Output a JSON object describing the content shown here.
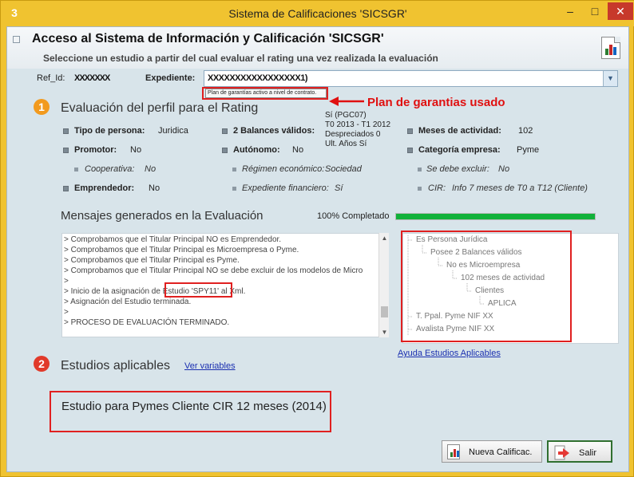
{
  "window": {
    "title": "Sistema de Calificaciones 'SICSGR'",
    "app_icon": "3",
    "min": "–",
    "max": "□",
    "close": "✕"
  },
  "header": {
    "title": "Acceso al Sistema de Información y Calificación 'SICSGR'",
    "subtitle": "Seleccione un estudio a partir del cual evaluar el rating una vez realizada la evaluación"
  },
  "ref": {
    "ref_label": "Ref_Id:",
    "ref_value": "XXXXXXX",
    "exp_label": "Expediente:",
    "exp_value": "XXXXXXXXXXXXXXXXX1)",
    "tooltip": "Plan de garantías activo a nivel de contrato."
  },
  "annotation": {
    "text": "Plan de garantias usado",
    "color": "#e01010"
  },
  "section1": {
    "number": "1",
    "title": "Evaluación del perfil para el Rating",
    "tipo_label": "Tipo de persona:",
    "tipo_value": "Juridica",
    "balances_label": "2 Balances válidos:",
    "balances_value": [
      "Sí (PGC07)",
      "T0 2013 - T1 2012",
      "Despreciados 0",
      "Ult. Años Sí"
    ],
    "meses_label": "Meses de actividad:",
    "meses_value": "102",
    "promotor_label": "Promotor:",
    "promotor_value": "No",
    "autonomo_label": "Autónomo:",
    "autonomo_value": "No",
    "categoria_label": "Categoría empresa:",
    "categoria_value": "Pyme",
    "cooperativa_label": "Cooperativa:",
    "cooperativa_value": "No",
    "regimen_label": "Régimen económico:",
    "regimen_value": "Sociedad",
    "excluir_label": "Se debe excluir:",
    "excluir_value": "No",
    "emprendedor_label": "Emprendedor:",
    "emprendedor_value": "No",
    "expfin_label": "Expediente financiero:",
    "expfin_value": "Sí",
    "cir_label": "CIR:",
    "cir_value": "Info 7 meses de T0 a T12 (Cliente)"
  },
  "messages": {
    "title": "Mensajes generados en la Evaluación",
    "progress_label": "100% Completado",
    "progress": 1.0,
    "lines": [
      "> Comprobamos que el Titular Principal NO es Emprendedor.",
      "> Comprobamos que el Titular Principal es Microempresa o Pyme.",
      "> Comprobamos que el Titular Principal es Pyme.",
      "> Comprobamos que el Titular Principal NO se debe excluir de los modelos de Micro",
      "> ",
      "> Inicio de la asignación de Estudio 'SPY11' al Xml.",
      "> Asignación del Estudio terminada.",
      "> ",
      "> PROCESO DE EVALUACIÓN TERMINADO."
    ]
  },
  "tree": {
    "nodes": [
      "Es Persona Jurídica",
      "Posee 2 Balances válidos",
      "No es Microempresa",
      "102 meses de actividad",
      "Clientes",
      "APLICA",
      "T. Ppal. Pyme NIF XX",
      "Avalista Pyme NIF XX"
    ]
  },
  "help_link": "Ayuda Estudios Aplicables",
  "section2": {
    "number": "2",
    "title": "Estudios aplicables",
    "link": "Ver variables",
    "study": "Estudio para Pymes Cliente CIR 12 meses (2014)"
  },
  "buttons": {
    "nueva": "Nueva Calificac.",
    "salir": "Salir"
  },
  "colors": {
    "accent": "#f0c330",
    "progress": "#11b13a",
    "annotation": "#e01010"
  }
}
